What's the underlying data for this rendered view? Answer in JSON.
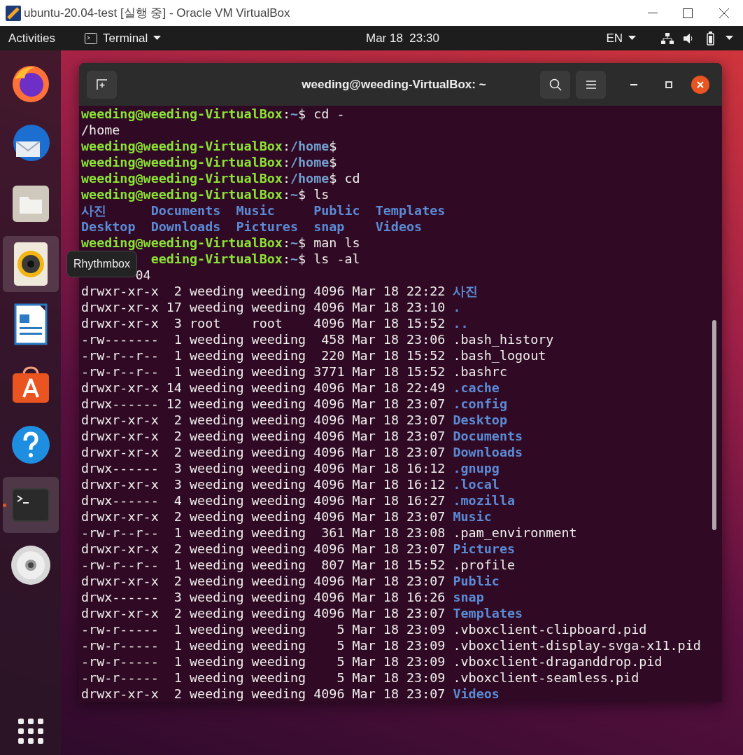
{
  "vm_window": {
    "title": "ubuntu-20.04-test [실행 중] - Oracle VM VirtualBox"
  },
  "top_bar": {
    "activities": "Activities",
    "app_menu": "Terminal",
    "clock": "Mar 18  23:30",
    "language": "EN"
  },
  "dock": {
    "items": [
      {
        "kind": "firefox",
        "highlighted": false,
        "running": false
      },
      {
        "kind": "thunderbird",
        "highlighted": false,
        "running": false
      },
      {
        "kind": "files",
        "highlighted": false,
        "running": false
      },
      {
        "kind": "rhythmbox",
        "highlighted": true,
        "running": false
      },
      {
        "kind": "writer",
        "highlighted": false,
        "running": false
      },
      {
        "kind": "software",
        "highlighted": false,
        "running": false
      },
      {
        "kind": "help",
        "highlighted": false,
        "running": false
      },
      {
        "kind": "terminal",
        "highlighted": true,
        "running": true
      },
      {
        "kind": "disc",
        "highlighted": false,
        "running": false
      }
    ],
    "tooltip": "Rhythmbox"
  },
  "terminal": {
    "title": "weeding@weeding-VirtualBox: ~",
    "lines": [
      {
        "kind": "prompt",
        "user": "weeding@weeding-VirtualBox",
        "separator": ":",
        "path": "~",
        "command": "$ cd -"
      },
      {
        "kind": "output",
        "text": "/home"
      },
      {
        "kind": "prompt",
        "user": "weeding@weeding-VirtualBox",
        "separator": ":",
        "path": "/home",
        "command": "$"
      },
      {
        "kind": "prompt",
        "user": "weeding@weeding-VirtualBox",
        "separator": ":",
        "path": "/home",
        "command": "$"
      },
      {
        "kind": "prompt",
        "user": "weeding@weeding-VirtualBox",
        "separator": ":",
        "path": "/home",
        "command": "$ cd"
      },
      {
        "kind": "prompt",
        "user": "weeding@weeding-VirtualBox",
        "separator": ":",
        "path": "~",
        "command": "$ ls"
      },
      {
        "kind": "ls",
        "names": [
          "사진",
          "Documents",
          "Music",
          "Public",
          "Templates"
        ]
      },
      {
        "kind": "ls",
        "names": [
          "Desktop",
          "Downloads",
          "Pictures",
          "snap",
          "Videos"
        ]
      },
      {
        "kind": "prompt",
        "user": "weeding@weeding-VirtualBox",
        "separator": ":",
        "path": "~",
        "command": "$ man ls"
      },
      {
        "kind": "prompt_covered",
        "user": "eeding-VirtualBox",
        "separator": ":",
        "path": "~",
        "command": "$ ls -al"
      },
      {
        "kind": "output_covered",
        "text": "04"
      },
      {
        "kind": "entry",
        "meta": "drwxr-xr-x  2 weeding weeding 4096 Mar 18 22:22",
        "name": "사진",
        "is_dir": true
      },
      {
        "kind": "entry",
        "meta": "drwxr-xr-x 17 weeding weeding 4096 Mar 18 23:10",
        "name": ".",
        "is_dir": true
      },
      {
        "kind": "entry",
        "meta": "drwxr-xr-x  3 root    root    4096 Mar 18 15:52",
        "name": "..",
        "is_dir": true
      },
      {
        "kind": "entry",
        "meta": "-rw-------  1 weeding weeding  458 Mar 18 23:06",
        "name": ".bash_history",
        "is_dir": false
      },
      {
        "kind": "entry",
        "meta": "-rw-r--r--  1 weeding weeding  220 Mar 18 15:52",
        "name": ".bash_logout",
        "is_dir": false
      },
      {
        "kind": "entry",
        "meta": "-rw-r--r--  1 weeding weeding 3771 Mar 18 15:52",
        "name": ".bashrc",
        "is_dir": false
      },
      {
        "kind": "entry",
        "meta": "drwxr-xr-x 14 weeding weeding 4096 Mar 18 22:49",
        "name": ".cache",
        "is_dir": true
      },
      {
        "kind": "entry",
        "meta": "drwx------ 12 weeding weeding 4096 Mar 18 23:07",
        "name": ".config",
        "is_dir": true
      },
      {
        "kind": "entry",
        "meta": "drwxr-xr-x  2 weeding weeding 4096 Mar 18 23:07",
        "name": "Desktop",
        "is_dir": true
      },
      {
        "kind": "entry",
        "meta": "drwxr-xr-x  2 weeding weeding 4096 Mar 18 23:07",
        "name": "Documents",
        "is_dir": true
      },
      {
        "kind": "entry",
        "meta": "drwxr-xr-x  2 weeding weeding 4096 Mar 18 23:07",
        "name": "Downloads",
        "is_dir": true
      },
      {
        "kind": "entry",
        "meta": "drwx------  3 weeding weeding 4096 Mar 18 16:12",
        "name": ".gnupg",
        "is_dir": true
      },
      {
        "kind": "entry",
        "meta": "drwxr-xr-x  3 weeding weeding 4096 Mar 18 16:12",
        "name": ".local",
        "is_dir": true
      },
      {
        "kind": "entry",
        "meta": "drwx------  4 weeding weeding 4096 Mar 18 16:27",
        "name": ".mozilla",
        "is_dir": true
      },
      {
        "kind": "entry",
        "meta": "drwxr-xr-x  2 weeding weeding 4096 Mar 18 23:07",
        "name": "Music",
        "is_dir": true
      },
      {
        "kind": "entry",
        "meta": "-rw-r--r--  1 weeding weeding  361 Mar 18 23:08",
        "name": ".pam_environment",
        "is_dir": false
      },
      {
        "kind": "entry",
        "meta": "drwxr-xr-x  2 weeding weeding 4096 Mar 18 23:07",
        "name": "Pictures",
        "is_dir": true
      },
      {
        "kind": "entry",
        "meta": "-rw-r--r--  1 weeding weeding  807 Mar 18 15:52",
        "name": ".profile",
        "is_dir": false
      },
      {
        "kind": "entry",
        "meta": "drwxr-xr-x  2 weeding weeding 4096 Mar 18 23:07",
        "name": "Public",
        "is_dir": true
      },
      {
        "kind": "entry",
        "meta": "drwx------  3 weeding weeding 4096 Mar 18 16:26",
        "name": "snap",
        "is_dir": true
      },
      {
        "kind": "entry",
        "meta": "drwxr-xr-x  2 weeding weeding 4096 Mar 18 23:07",
        "name": "Templates",
        "is_dir": true
      },
      {
        "kind": "entry",
        "meta": "-rw-r-----  1 weeding weeding    5 Mar 18 23:09",
        "name": ".vboxclient-clipboard.pid",
        "is_dir": false
      },
      {
        "kind": "entry",
        "meta": "-rw-r-----  1 weeding weeding    5 Mar 18 23:09",
        "name": ".vboxclient-display-svga-x11.pid",
        "is_dir": false
      },
      {
        "kind": "entry",
        "meta": "-rw-r-----  1 weeding weeding    5 Mar 18 23:09",
        "name": ".vboxclient-draganddrop.pid",
        "is_dir": false
      },
      {
        "kind": "entry",
        "meta": "-rw-r-----  1 weeding weeding    5 Mar 18 23:09",
        "name": ".vboxclient-seamless.pid",
        "is_dir": false
      },
      {
        "kind": "entry",
        "meta": "drwxr-xr-x  2 weeding weeding 4096 Mar 18 23:07",
        "name": "Videos",
        "is_dir": true
      }
    ]
  }
}
